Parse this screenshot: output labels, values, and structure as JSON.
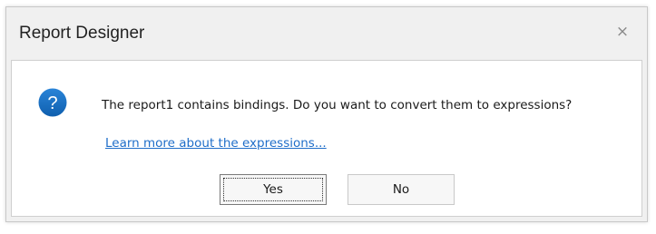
{
  "window": {
    "title": "Report Designer",
    "close_glyph": "×"
  },
  "message": {
    "icon": "question-icon",
    "text": "The report1 contains bindings. Do you want to convert them to expressions?",
    "link_text": "Learn more about the expressions..."
  },
  "buttons": {
    "yes_label": "Yes",
    "no_label": "No"
  },
  "colors": {
    "icon_blue": "#1a73c8",
    "link_blue": "#1f6ec9",
    "dialog_bg": "#f0f0f0"
  }
}
